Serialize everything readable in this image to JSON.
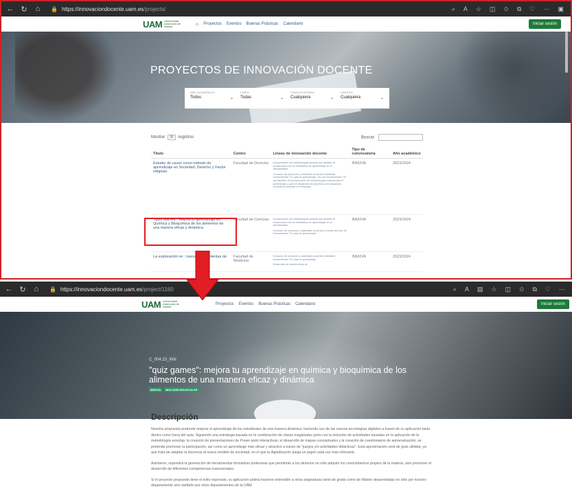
{
  "top": {
    "browser": {
      "url_host": "https://innovaciondocente.uam.es",
      "url_path": "/projects/"
    },
    "site": {
      "logo_mark": "UAM",
      "logo_text": "Universidad Autónoma de Madrid",
      "nav": [
        "Proyectos",
        "Eventos",
        "Buenas Prácticas",
        "Calendario"
      ],
      "login": "Iniciar sesión"
    },
    "hero_title": "PROYECTOS DE INNOVACIÓN DOCENTE",
    "filters": [
      {
        "label": "AÑO ACADÉMICO",
        "value": "Todos"
      },
      {
        "label": "LÍNEA",
        "value": "Todas"
      },
      {
        "label": "CONVOCATORIA",
        "value": "Cualquiera"
      },
      {
        "label": "CENTRO",
        "value": "Cualquiera"
      }
    ],
    "controls": {
      "show_prefix": "Mostrar",
      "page_length": "30",
      "show_suffix": "registros",
      "search_label": "Buscar:"
    },
    "columns": [
      "Título",
      "Centro",
      "Líneas de innovación docente",
      "Tipo de convocatoria",
      "Año académico"
    ],
    "rows": [
      {
        "title": "Estudio de casos como método de aprendizaje en Sociedad, Derecho y Factor religioso",
        "centre": "Facultad de Derecho",
        "lines": [
          "Incorporación de metodologías activas que faciliten la consecución de los resultados de aprendizaje en el estudiantado.",
          "Creación de recursos y materiales docentes mediante herramientas TIC para el aprendizaje. Uso de herramientas TIC que faciliten la incorporación de metodologías activas para el aprendizaje y para el desarrollo de procesos de evaluación. Innovación docente en Prácticas."
        ],
        "type": "INNOVA",
        "year": "2023/2024"
      },
      {
        "title": "\"Quiz Games\": Mejora tu aprendizaje en Química y Bioquímica de los alimentos de una manera eficaz y dinámica",
        "centre": "Facultad de Ciencias",
        "lines": [
          "Incorporación de metodologías activas que faciliten la consecución de los resultados de aprendizaje en el estudiantado.",
          "Creación de recursos y materiales docentes a través del uso de herramientas TIC para el aprendizaje."
        ],
        "type": "INNOVA",
        "year": "2023/2024"
      },
      {
        "title": "La exploración ne                                 : nuevas herramientas de",
        "centre": "Facultad de Medicina",
        "lines": [
          "Creación de recursos y materiales docentes mediante herramientas TIC para el aprendizaje.",
          "Desarrollo de instrumentos de"
        ],
        "type": "INNOVA",
        "year": "2023/2024"
      }
    ]
  },
  "bottom": {
    "browser": {
      "url_host": "https://innovaciondocente.uam.es",
      "url_path": "/project/1160"
    },
    "site": {
      "logo_mark": "UAM",
      "logo_text": "Universidad Autónoma de Madrid",
      "nav": [
        "Proyectos",
        "Eventos",
        "Buenas Prácticas",
        "Calendario"
      ],
      "login": "Iniciar sesión"
    },
    "project_code": "C_004.23_INN",
    "project_title": "\"quiz games\": mejora tu aprendizaje en química y bioquímica de los alimentos de una manera eficaz y dinámica",
    "tags": [
      "INNOVA",
      "BIOLOGÍA MOLECULAR"
    ],
    "description_heading": "Descripción",
    "paragraphs": [
      "Nuestra propuesta pretende mejorar el aprendizaje de los estudiantes de una manera dinámica, haciendo uso de las nuevas tecnologías digitales a través de su aplicación tanto dentro como fuera del aula. Siguiendo una estrategia basada en la combinación de clases magistrales junto con la inclusión de actividades basadas en la aplicación de la metodología wooclap, la creación de presentaciones de Power point interactivas, el desarrollo de mapas conceptuales y la creación de cuestionarios de autoevaluación, se pretende promover la participación, así como un aprendizaje más eficaz y atractivo a través de \"juegos y/o actividades didácticas\". Esta aproximación será de gran utilidad, ya que trata de adaptar la docencia al nuevo modelo de sociedad, en el que la digitalización juega un papel cada vez más relevante.",
      "Asimismo, supondrá la generación de herramientas formativas poderosas que permitirán a los alumnos no sólo adquirir los conocimientos propios de la materia, sino promover el desarrollo de diferentes competencias transversales.",
      "Si el proyecto propuesto tiene el éxito esperado, su aplicación podría hacerse extensible a otras asignaturas tanto de grado como de Máster desarrolladas no sólo por nuestro departamento sino también por otros departamentos de la UAM."
    ]
  },
  "colors": {
    "accent_green": "#1d7a3a",
    "highlight_red": "#e21d23",
    "tag_green": "#2a9a6a"
  }
}
